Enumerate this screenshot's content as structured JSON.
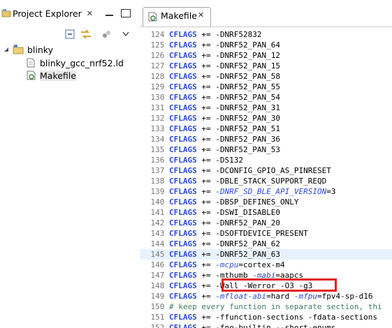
{
  "explorer": {
    "tab_label": "Project Explorer",
    "close_symbol": "✕",
    "tree": [
      {
        "label": "blinky",
        "icon": "project-folder-icon",
        "expanded": true
      },
      {
        "label": "blinky_gcc_nrf52.ld",
        "icon": "file-icon"
      },
      {
        "label": "Makefile",
        "icon": "makefile-icon",
        "selected": true
      }
    ]
  },
  "editor": {
    "tab_label": "Makefile",
    "close_symbol": "✕",
    "var": "CFLAGS",
    "op": "+=",
    "lines": [
      {
        "n": "124",
        "parts": [
          {
            "t": "-DNRF52832",
            "c": "val"
          }
        ]
      },
      {
        "n": "125",
        "parts": [
          {
            "t": "-DNRF52_PAN_64",
            "c": "val"
          }
        ]
      },
      {
        "n": "126",
        "parts": [
          {
            "t": "-DNRF52_PAN_12",
            "c": "val"
          }
        ]
      },
      {
        "n": "127",
        "parts": [
          {
            "t": "-DNRF52_PAN_15",
            "c": "val"
          }
        ]
      },
      {
        "n": "128",
        "parts": [
          {
            "t": "-DNRF52_PAN_58",
            "c": "val"
          }
        ]
      },
      {
        "n": "129",
        "parts": [
          {
            "t": "-DNRF52_PAN_55",
            "c": "val"
          }
        ]
      },
      {
        "n": "130",
        "parts": [
          {
            "t": "-DNRF52_PAN_54",
            "c": "val"
          }
        ]
      },
      {
        "n": "131",
        "parts": [
          {
            "t": "-DNRF52_PAN_31",
            "c": "val"
          }
        ]
      },
      {
        "n": "132",
        "parts": [
          {
            "t": "-DNRF52_PAN_30",
            "c": "val"
          }
        ]
      },
      {
        "n": "133",
        "parts": [
          {
            "t": "-DNRF52_PAN_51",
            "c": "val"
          }
        ]
      },
      {
        "n": "134",
        "parts": [
          {
            "t": "-DNRF52_PAN_36",
            "c": "val"
          }
        ]
      },
      {
        "n": "135",
        "parts": [
          {
            "t": "-DNRF52_PAN_53",
            "c": "val"
          }
        ]
      },
      {
        "n": "136",
        "parts": [
          {
            "t": "-DS132",
            "c": "val"
          }
        ]
      },
      {
        "n": "137",
        "parts": [
          {
            "t": "-DCONFIG_GPIO_AS_PINRESET",
            "c": "val"
          }
        ]
      },
      {
        "n": "138",
        "parts": [
          {
            "t": "-DBLE_STACK_SUPPORT_REQD",
            "c": "val"
          }
        ]
      },
      {
        "n": "139",
        "parts": [
          {
            "t": "-DNRF_SD_BLE_API_VERSION",
            "c": "ital"
          },
          {
            "t": "=3",
            "c": "val"
          }
        ]
      },
      {
        "n": "140",
        "parts": [
          {
            "t": "-DBSP_DEFINES_ONLY",
            "c": "val"
          }
        ]
      },
      {
        "n": "141",
        "parts": [
          {
            "t": "-DSWI_DISABLE0",
            "c": "val"
          }
        ]
      },
      {
        "n": "142",
        "parts": [
          {
            "t": "-DNRF52_PAN_20",
            "c": "val"
          }
        ]
      },
      {
        "n": "143",
        "parts": [
          {
            "t": "-DSOFTDEVICE_PRESENT",
            "c": "val"
          }
        ]
      },
      {
        "n": "144",
        "parts": [
          {
            "t": "-DNRF52_PAN_62",
            "c": "val"
          }
        ]
      },
      {
        "n": "145",
        "parts": [
          {
            "t": "-DNRF52_PAN_63",
            "c": "val"
          }
        ],
        "current": true
      },
      {
        "n": "146",
        "parts": [
          {
            "t": "-mcpu",
            "c": "ital"
          },
          {
            "t": "=cortex-m4",
            "c": "val"
          }
        ]
      },
      {
        "n": "147",
        "parts": [
          {
            "t": "-mthumb ",
            "c": "val"
          },
          {
            "t": "-mabi",
            "c": "ital"
          },
          {
            "t": "=aapcs",
            "c": "val"
          }
        ]
      },
      {
        "n": "148",
        "parts": [
          {
            "t": "-Wall -Werror -O3 -g3",
            "c": "val"
          }
        ]
      },
      {
        "n": "149",
        "parts": [
          {
            "t": "-mfloat-abi",
            "c": "ital"
          },
          {
            "t": "=hard ",
            "c": "val"
          },
          {
            "t": "-mfpu",
            "c": "ital"
          },
          {
            "t": "=fpv4-sp-d16",
            "c": "val"
          }
        ]
      },
      {
        "n": "150",
        "comment": "# keep every function in separate section, thi"
      },
      {
        "n": "151",
        "parts": [
          {
            "t": "-ffunction-sections -fdata-sections",
            "c": "val"
          }
        ]
      },
      {
        "n": "152",
        "parts": [
          {
            "t": "-fno-builtin --short-enums",
            "c": "val"
          }
        ]
      }
    ],
    "highlight_color": "#e31e1e"
  }
}
